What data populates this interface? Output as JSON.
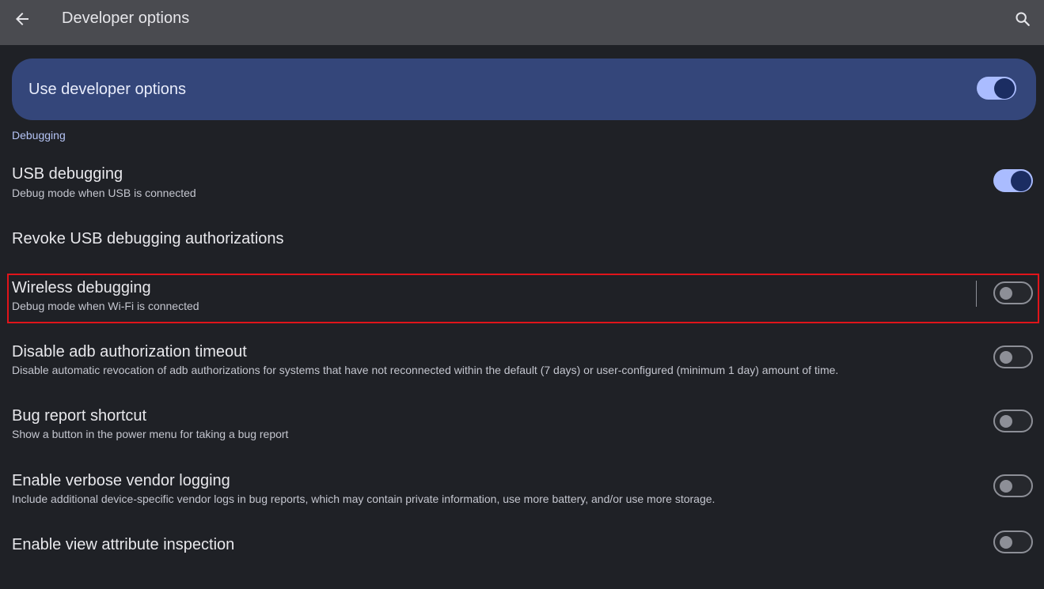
{
  "app_bar": {
    "title": "Developer options",
    "back_icon": "arrow-left-icon",
    "search_icon": "search-icon"
  },
  "master_switch": {
    "label": "Use developer options",
    "state": "on"
  },
  "section": {
    "title": "Debugging"
  },
  "settings": [
    {
      "title": "USB debugging",
      "subtitle": "Debug mode when USB is connected",
      "toggle": "on"
    },
    {
      "title": "Revoke USB debugging authorizations",
      "subtitle": ""
    },
    {
      "title": "Wireless debugging",
      "subtitle": "Debug mode when Wi-Fi is connected",
      "toggle": "off",
      "highlighted": true
    },
    {
      "title": "Disable adb authorization timeout",
      "subtitle": "Disable automatic revocation of adb authorizations for systems that have not reconnected within the default (7 days) or user-configured (minimum 1 day) amount of time.",
      "toggle": "off"
    },
    {
      "title": "Bug report shortcut",
      "subtitle": "Show a button in the power menu for taking a bug report",
      "toggle": "off"
    },
    {
      "title": "Enable verbose vendor logging",
      "subtitle": "Include additional device-specific vendor logs in bug reports, which may contain private information, use more battery, and/or use more storage.",
      "toggle": "off"
    },
    {
      "title": "Enable view attribute inspection",
      "subtitle": "",
      "toggle": "off"
    }
  ],
  "colors": {
    "background": "#1f2126",
    "app_bar": "#4a4b50",
    "master_card": "#34467a",
    "accent": "#aabcff",
    "highlight_border": "#e0141a"
  }
}
